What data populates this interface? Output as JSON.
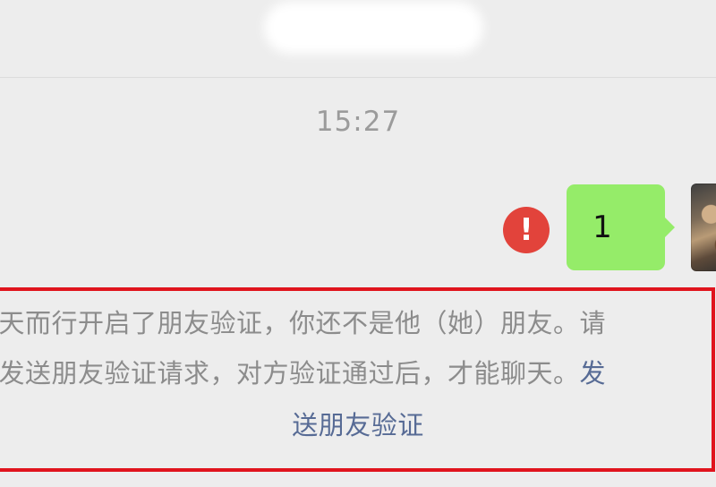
{
  "header": {
    "title": ""
  },
  "chat": {
    "timestamp": "15:27",
    "message": {
      "text": "1",
      "status_icon": "exclamation-icon",
      "bubble_color": "#95ec69"
    },
    "avatar": {
      "icon": "user-photo"
    }
  },
  "notice": {
    "line1": "逆天而行开启了朋友验证，你还不是他（她）朋友。请",
    "line2_text": "先发送朋友验证请求，对方验证通过后，才能聊天。",
    "line2_link": "发",
    "line3_link": "送朋友验证",
    "text_color": "#8c8c8c",
    "link_color": "#576b95",
    "highlight_color": "#e0141d"
  },
  "colors": {
    "background": "#ededed",
    "warning": "#e2433b"
  }
}
